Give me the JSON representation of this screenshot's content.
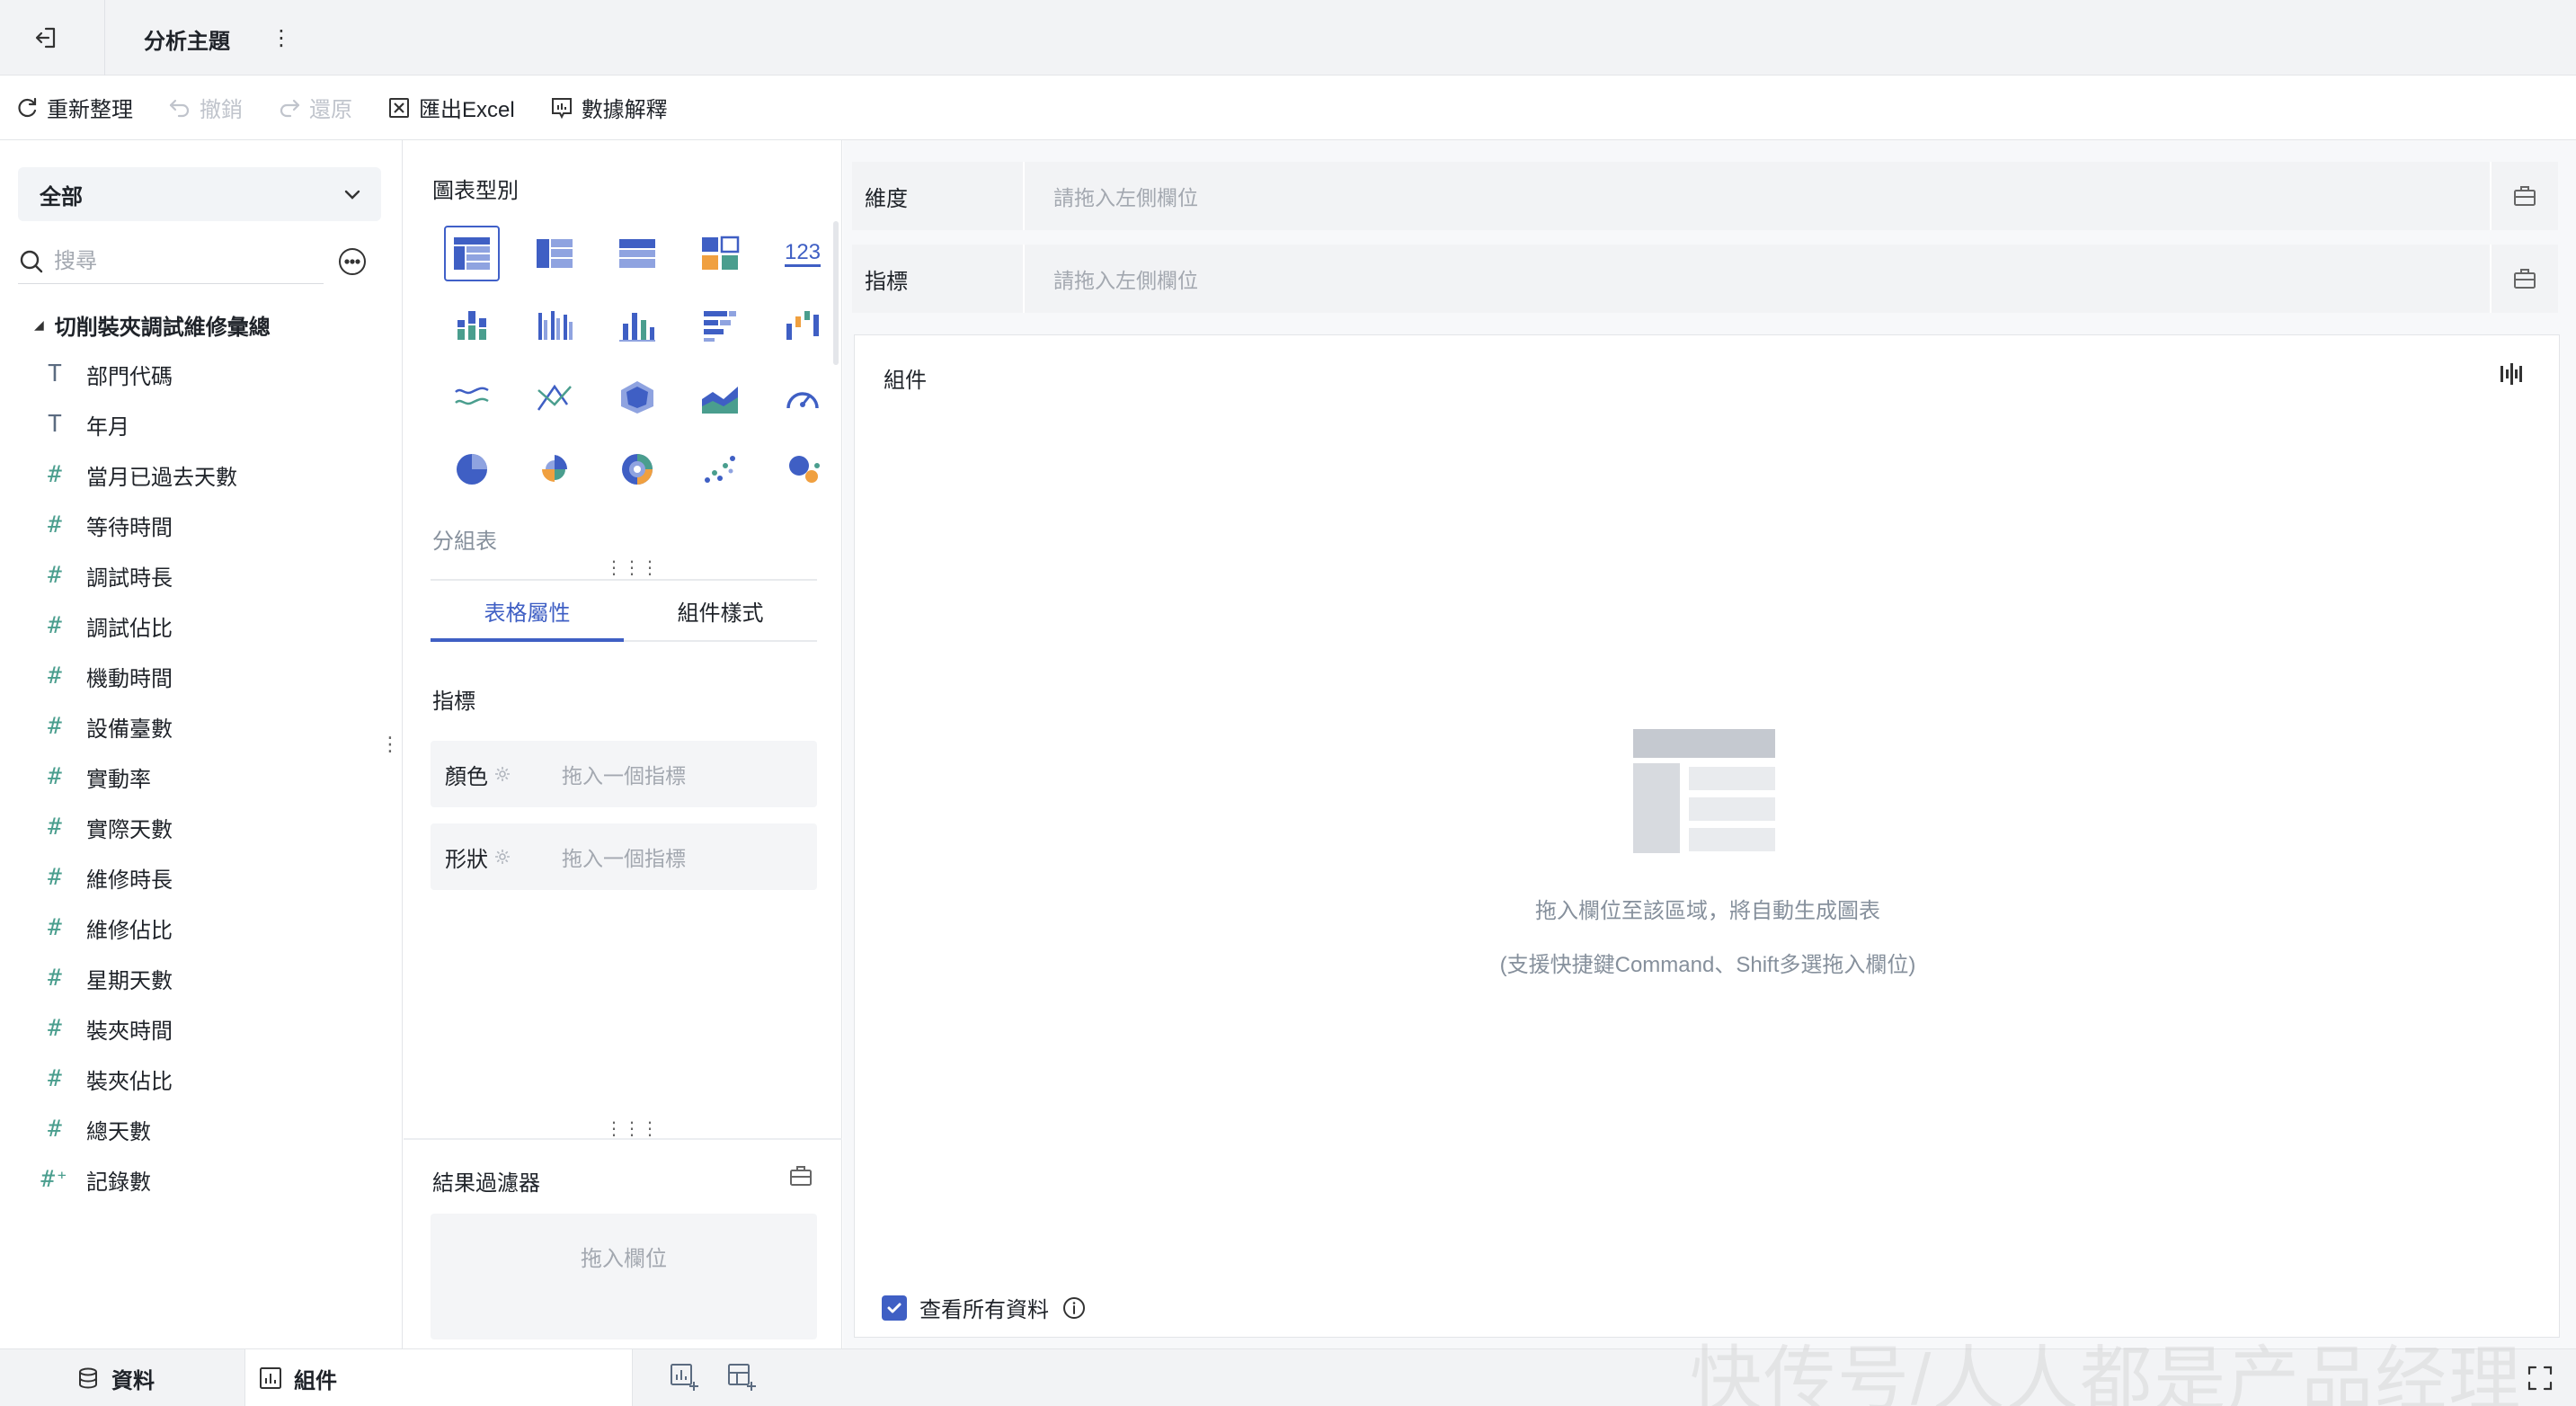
{
  "titlebar": {
    "title": "分析主題",
    "more": "⋮"
  },
  "toolbar": {
    "refresh": "重新整理",
    "undo": "撤銷",
    "redo": "還原",
    "export": "匯出Excel",
    "explain": "數據解釋"
  },
  "left": {
    "dataset": "全部",
    "search_placeholder": "搜尋",
    "tree_root": "切削裝夾調試維修彙總",
    "fields": [
      {
        "type": "text",
        "icon": "T",
        "label": "部門代碼"
      },
      {
        "type": "text",
        "icon": "T",
        "label": "年月"
      },
      {
        "type": "number",
        "icon": "#",
        "label": "當月已過去天數"
      },
      {
        "type": "number",
        "icon": "#",
        "label": "等待時間"
      },
      {
        "type": "number",
        "icon": "#",
        "label": "調試時長"
      },
      {
        "type": "number",
        "icon": "#",
        "label": "調試佔比"
      },
      {
        "type": "number",
        "icon": "#",
        "label": "機動時間"
      },
      {
        "type": "number",
        "icon": "#",
        "label": "設備臺數"
      },
      {
        "type": "number",
        "icon": "#",
        "label": "實動率"
      },
      {
        "type": "number",
        "icon": "#",
        "label": "實際天數"
      },
      {
        "type": "number",
        "icon": "#",
        "label": "維修時長"
      },
      {
        "type": "number",
        "icon": "#",
        "label": "維修佔比"
      },
      {
        "type": "number",
        "icon": "#",
        "label": "星期天數"
      },
      {
        "type": "number",
        "icon": "#",
        "label": "裝夾時間"
      },
      {
        "type": "number",
        "icon": "#",
        "label": "裝夾佔比"
      },
      {
        "type": "number",
        "icon": "#",
        "label": "總天數"
      },
      {
        "type": "number",
        "icon": "#⁺",
        "label": "記錄數"
      }
    ]
  },
  "middle": {
    "chart_type_title": "圖表型別",
    "chart_caption": "分組表",
    "kpi_icon_text": "123",
    "tabs": [
      {
        "label": "表格屬性",
        "active": true
      },
      {
        "label": "組件樣式",
        "active": false
      }
    ],
    "metric_section": "指標",
    "color_label": "顏色",
    "color_placeholder": "拖入一個指標",
    "shape_label": "形狀",
    "shape_placeholder": "拖入一個指標",
    "filter_title": "結果過濾器",
    "filter_placeholder": "拖入欄位"
  },
  "right": {
    "dimension_label": "維度",
    "dimension_placeholder": "請拖入左側欄位",
    "metric_label": "指標",
    "metric_placeholder": "請拖入左側欄位",
    "canvas_title": "組件",
    "empty_line1": "拖入欄位至該區域，將自動生成圖表",
    "empty_line2": "(支援快捷鍵Command、Shift多選拖入欄位)",
    "view_all": "查看所有資料",
    "view_all_checked": true
  },
  "bottom": {
    "data_tab": "資料",
    "components_tab": "組件"
  },
  "watermark": "快传号/人人都是产品经理",
  "colors": {
    "accent": "#3f5fc4",
    "teal": "#4a9e8e",
    "orange": "#f0a040",
    "gray_text": "#86909c"
  }
}
